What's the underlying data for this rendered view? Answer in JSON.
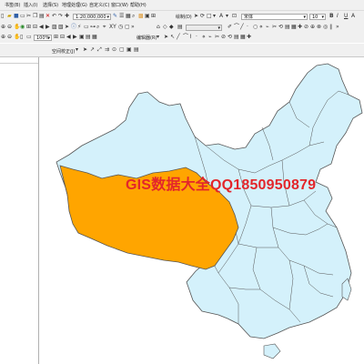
{
  "menu": {
    "items": [
      "书签(B)",
      "插入(I)",
      "选择(S)",
      "地理处理(G)",
      "自定义(C)",
      "窗口(W)",
      "帮助(H)"
    ]
  },
  "toolbar": {
    "scale_value": "1:20,000,000",
    "drawing_label": "绘制(D)",
    "font_name": "宋体",
    "font_size": "10"
  },
  "toolbar2": {
    "zoom_value": "100%",
    "editor_label": "编辑器(R)"
  },
  "toolbar3": {
    "georef_label": "空间校正(J)"
  },
  "map": {
    "watermark": "GIS数据大全QQ1850950879",
    "colors": {
      "highlight": "#FFA500",
      "base": "#D4F1FB",
      "boundary": "#555555"
    }
  }
}
